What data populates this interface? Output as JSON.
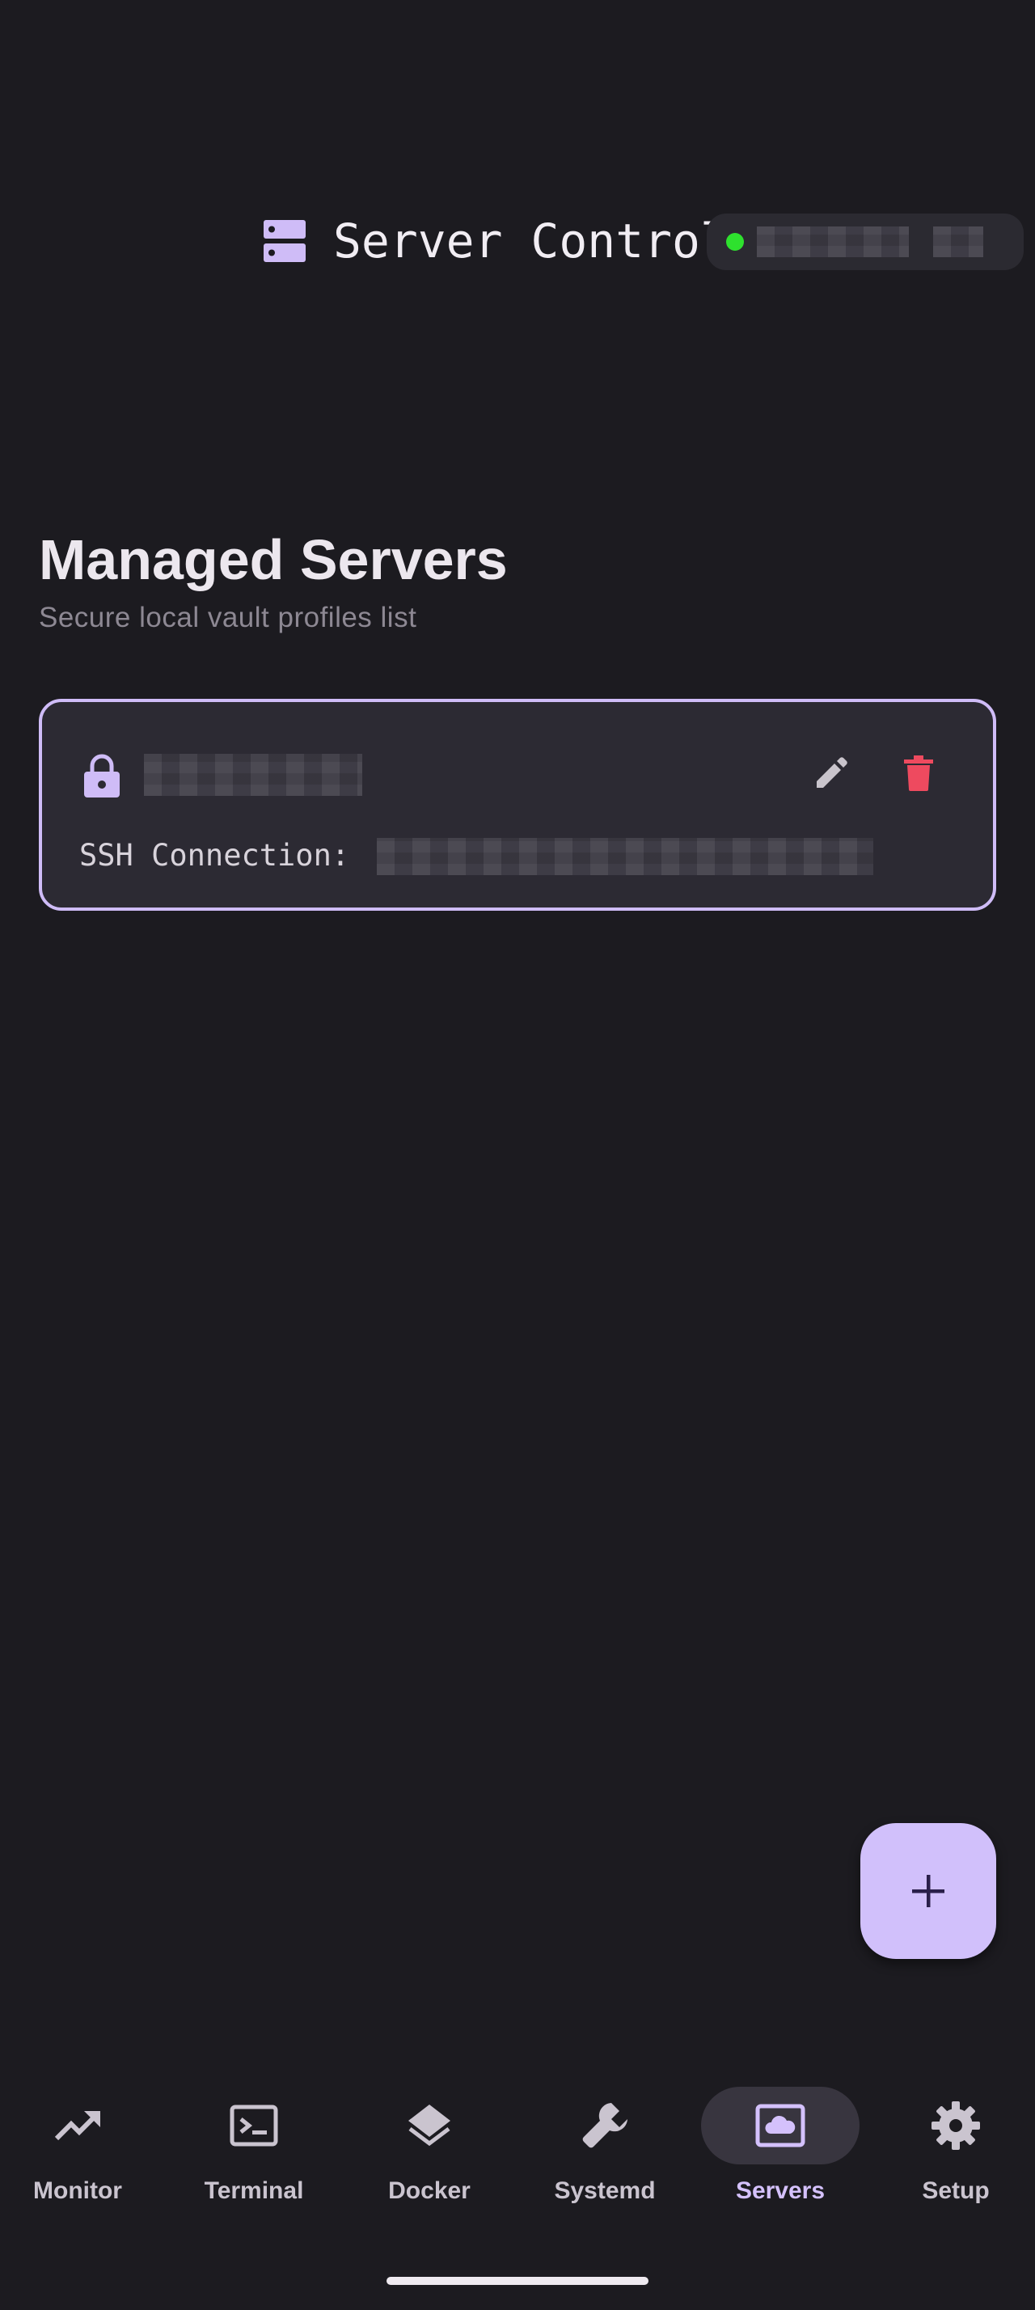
{
  "header": {
    "title": "Server Control",
    "status_color": "#2ee12e",
    "logo_icon": "server-stack-icon"
  },
  "main": {
    "title": "Managed Servers",
    "subtitle": "Secure local vault profiles list"
  },
  "servers": [
    {
      "ssh_label": "SSH Connection:",
      "icon": "lock-icon",
      "edit_icon": "pencil-icon",
      "delete_icon": "trash-icon"
    }
  ],
  "fab": {
    "icon": "plus-icon"
  },
  "nav": {
    "items": [
      {
        "label": "Monitor",
        "icon": "trending-up-icon",
        "active": false
      },
      {
        "label": "Terminal",
        "icon": "terminal-icon",
        "active": false
      },
      {
        "label": "Docker",
        "icon": "layers-icon",
        "active": false
      },
      {
        "label": "Systemd",
        "icon": "wrench-icon",
        "active": false
      },
      {
        "label": "Servers",
        "icon": "cloud-screen-icon",
        "active": true
      },
      {
        "label": "Setup",
        "icon": "gear-icon",
        "active": false
      }
    ]
  },
  "colors": {
    "background": "#1c1b20",
    "accent": "#cfbcf7",
    "danger": "#ee4a5f",
    "card": "#2c2a33"
  }
}
